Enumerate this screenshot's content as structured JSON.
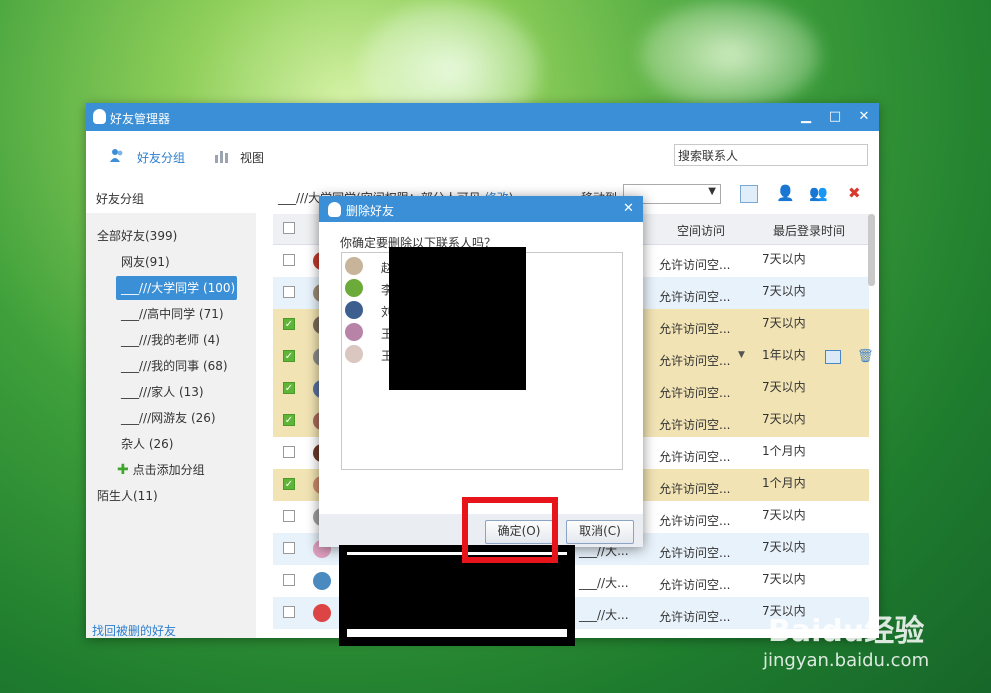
{
  "window": {
    "title": "好友管理器",
    "controls": [
      "minimize",
      "maximize",
      "close"
    ]
  },
  "toolbar": {
    "friend_groups_label": "好友分组",
    "view_label": "视图",
    "search_placeholder": "搜索联系人"
  },
  "sidebar": {
    "header": "好友分组",
    "all_friends": "全部好友(399)",
    "groups": [
      {
        "label": "网友(91)",
        "selected": false
      },
      {
        "label": "___///大学同学 (100)",
        "selected": true
      },
      {
        "label": "___//高中同学 (71)",
        "selected": false
      },
      {
        "label": "___///我的老师 (4)",
        "selected": false
      },
      {
        "label": "___///我的同事 (68)",
        "selected": false
      },
      {
        "label": "___///家人 (13)",
        "selected": false
      },
      {
        "label": "___///网游友 (26)",
        "selected": false
      },
      {
        "label": "杂人 (26)",
        "selected": false
      }
    ],
    "add_group": "点击添加分组",
    "strangers": "陌生人(11)",
    "recover": "找回被删的好友"
  },
  "main": {
    "group_title_prefix": "___///大学同学(空间权限：部分人可见 ",
    "group_title_link": "修改",
    "group_title_suffix": ")",
    "move_to": "移动到",
    "columns": {
      "space_access": "空间访问",
      "last_login": "最后登录时间"
    },
    "rows": [
      {
        "checked": false,
        "style": "a",
        "space": "允许访问空...",
        "login": "7天以内"
      },
      {
        "checked": false,
        "style": "b",
        "space": "允许访问空...",
        "login": "7天以内"
      },
      {
        "checked": true,
        "style": "y",
        "space": "允许访问空...",
        "login": "7天以内"
      },
      {
        "checked": true,
        "style": "y",
        "space": "允许访问空...",
        "login": "1年以内"
      },
      {
        "checked": true,
        "style": "y",
        "space": "允许访问空...",
        "login": "7天以内"
      },
      {
        "checked": true,
        "style": "y",
        "space": "允许访问空...",
        "login": "7天以内"
      },
      {
        "checked": false,
        "style": "a",
        "space": "允许访问空...",
        "login": "1个月内"
      },
      {
        "checked": true,
        "style": "y",
        "space": "允许访问空...",
        "login": "1个月内"
      },
      {
        "checked": false,
        "style": "a",
        "space": "允许访问空...",
        "login": "7天以内"
      },
      {
        "checked": false,
        "style": "b",
        "space": "允许访问空...",
        "login": "7天以内"
      },
      {
        "checked": false,
        "style": "a",
        "space": "允许访问空...",
        "login": "7天以内"
      },
      {
        "checked": false,
        "style": "b",
        "space": "允许访问空...",
        "login": "7天以内"
      }
    ],
    "row_group_short": "___//大..."
  },
  "dialog": {
    "title": "删除好友",
    "question": "你确定要删除以下联系人吗？",
    "contacts": [
      {
        "name": "赵"
      },
      {
        "name": "李"
      },
      {
        "name": "刘"
      },
      {
        "name": "王"
      },
      {
        "name": "王"
      }
    ],
    "ok_label": "确定(O)",
    "cancel_label": "取消(C)"
  },
  "watermark": {
    "brand": "Baidu经验",
    "url": "jingyan.baidu.com"
  },
  "colors": {
    "accent": "#3a8fd6",
    "selected_row": "#f1e3b3",
    "alt_row": "#e8f2fb",
    "highlight": "#e8141c",
    "check_green": "#5fb536"
  }
}
